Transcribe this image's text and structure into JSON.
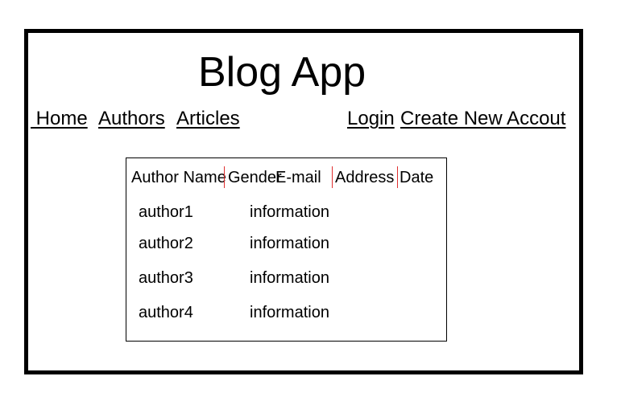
{
  "app": {
    "title": "Blog App"
  },
  "nav": {
    "home": " Home",
    "authors": "Authors",
    "articles": "Articles",
    "login": "Login",
    "create_account": "Create New Accout"
  },
  "table": {
    "headers": [
      "Author Name",
      "Gender",
      "E-mail",
      "Address",
      "Date"
    ],
    "rows": [
      {
        "author": "author1",
        "info": "information"
      },
      {
        "author": "author2",
        "info": "information"
      },
      {
        "author": "author3",
        "info": "information"
      },
      {
        "author": "author4",
        "info": "information"
      }
    ]
  },
  "colors": {
    "border": "#000000",
    "column_separator": "#e03030"
  }
}
